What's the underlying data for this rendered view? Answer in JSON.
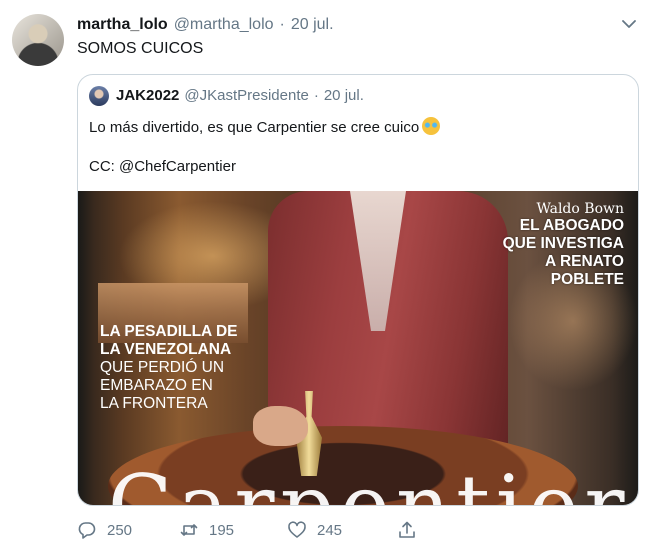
{
  "tweet": {
    "author_name": "martha_lolo",
    "author_handle": "@martha_lolo",
    "separator": "·",
    "date": "20 jul.",
    "text": "SOMOS CUICOS"
  },
  "quoted_tweet": {
    "author_name": "JAK2022",
    "author_handle": "@JKastPresidente",
    "separator": "·",
    "date": "20 jul.",
    "text": "Lo más divertido, es que Carpentier se cree cuico",
    "emoji": "face-with-tears-of-joy",
    "cc_text": "CC: @ChefCarpentier"
  },
  "magazine_cover": {
    "byline": "Waldo Bown",
    "right_headline": [
      "EL ABOGADO",
      "QUE INVESTIGA",
      "A RENATO",
      "POBLETE"
    ],
    "left_headline_bold": [
      "LA PESADILLA DE",
      "LA VENEZOLANA"
    ],
    "left_headline_thin": [
      "QUE PERDIÓ UN",
      "EMBARAZO EN",
      "LA FRONTERA"
    ],
    "masthead": "Carpentier"
  },
  "actions": {
    "reply_count": "250",
    "retweet_count": "195",
    "like_count": "245",
    "reply_icon": "speech-bubble-icon",
    "retweet_icon": "retweet-arrows-icon",
    "like_icon": "heart-icon",
    "share_icon": "share-upload-icon"
  },
  "colors": {
    "secondary_text": "#657786",
    "border": "#ccd6dd",
    "primary_text": "#14171a"
  }
}
